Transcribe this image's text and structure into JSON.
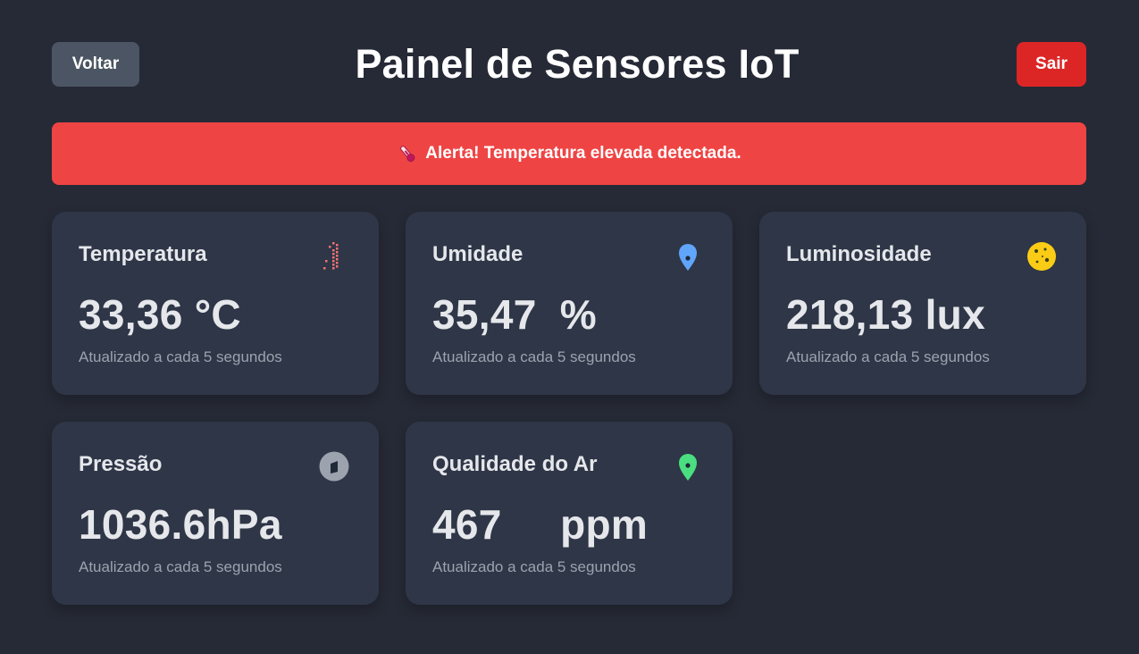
{
  "header": {
    "back_label": "Voltar",
    "title": "Painel de Sensores IoT",
    "exit_label": "Sair"
  },
  "alert": {
    "text": "Alerta! Temperatura elevada detectada.",
    "icon": "thermometer-icon",
    "color": "#ef4444"
  },
  "sensors": [
    {
      "title": "Temperatura",
      "value": "33,36",
      "unit": "°C",
      "note": "Atualizado a cada 5 segundos",
      "icon": "thermometer-icon",
      "icon_color": "#f87171"
    },
    {
      "title": "Umidade",
      "value": "35,47",
      "unit": "%",
      "note": "Atualizado a cada 5 segundos",
      "icon": "droplet-icon",
      "icon_color": "#60a5fa"
    },
    {
      "title": "Luminosidade",
      "value": "218,13",
      "unit": "lux",
      "note": "Atualizado a cada 5 segundos",
      "icon": "sun-icon",
      "icon_color": "#facc15"
    },
    {
      "title": "Pressão",
      "value": "1036.6",
      "unit": "hPa",
      "note": "Atualizado a cada 5 segundos",
      "icon": "gauge-icon",
      "icon_color": "#9ca3af"
    },
    {
      "title": "Qualidade do Ar",
      "value": "467",
      "unit": "ppm",
      "note": "Atualizado a cada 5 segundos",
      "icon": "leaf-icon",
      "icon_color": "#4ade80"
    }
  ],
  "colors": {
    "background": "#262a36",
    "card": "#2e3647",
    "back_button": "#4b5563",
    "exit_button": "#dc2626"
  }
}
